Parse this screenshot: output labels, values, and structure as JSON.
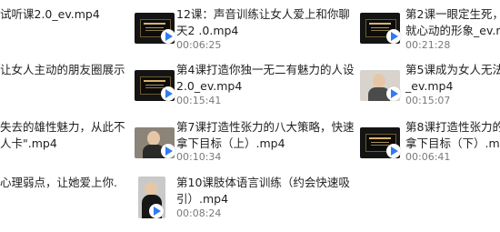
{
  "files": [
    {
      "title": "试听课2.0_ev.mp4"
    },
    {
      "title": "12课：声音训练让女人爱上和你聊\n天2 .0.mp4",
      "duration": "00:06:25"
    },
    {
      "title": "第2课一眼定生死，\n就心动的形象_ev.m",
      "duration": "00:21:28"
    },
    {
      "title": "让女人主动的朋友圈展示"
    },
    {
      "title": "第4课打造你独一无二有魅力的人设\n2.0_ev.mp4",
      "duration": "00:15:41"
    },
    {
      "title": "第5课成为女人无法\n_ev.mp4",
      "duration": "00:15:07"
    },
    {
      "title": "失去的雄性魅力，从此不\n人卡\".mp4"
    },
    {
      "title": "第7课打造性张力的八大策略，快速\n拿下目标（上）.mp4",
      "duration": "00:10:34"
    },
    {
      "title": "第8课打造性张力的\n拿下目标（下）.mp",
      "duration": "00:06:41"
    },
    {
      "title": "心理弱点，让她爱上你."
    },
    {
      "title": "第10课肢体语言训练（约会快速吸\n引）.mp4",
      "duration": "00:08:24"
    }
  ],
  "icons": {
    "badge_color": "#2f7bf6"
  }
}
